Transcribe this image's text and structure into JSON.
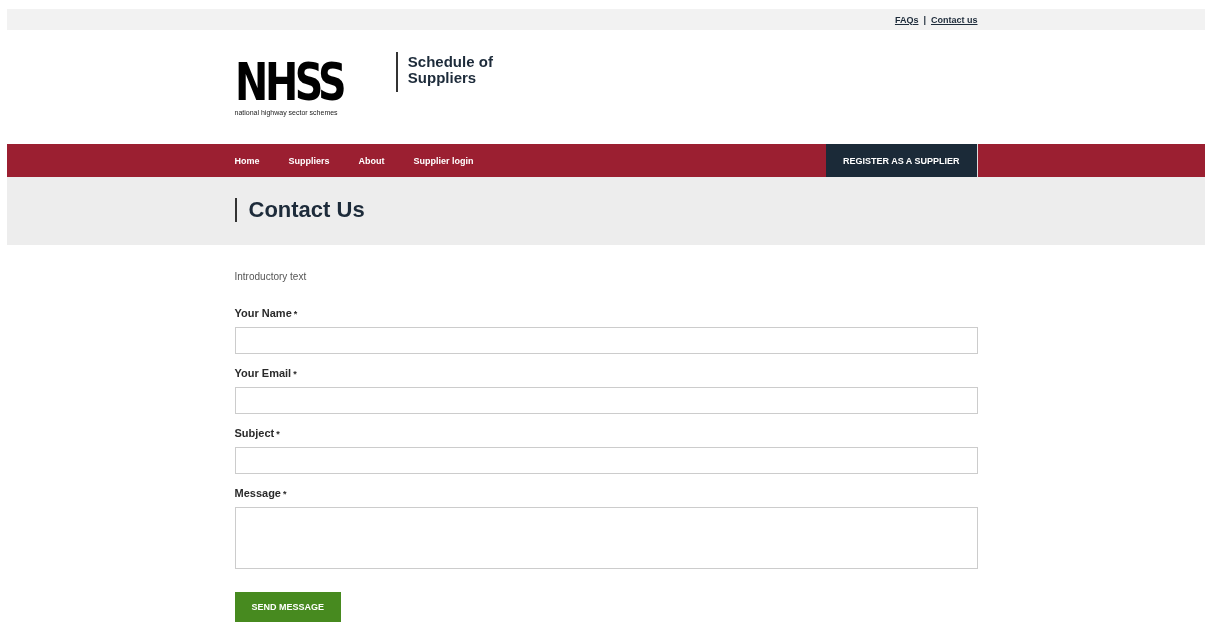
{
  "top_links": [
    {
      "label": "FAQs"
    },
    {
      "label": "Contact us"
    }
  ],
  "top_separator": "|",
  "logo": {
    "mark": "NHSS",
    "tagline": "national highway sector schemes"
  },
  "site_title": "Schedule of Suppliers",
  "nav": {
    "items": [
      {
        "label": "Home"
      },
      {
        "label": "Suppliers"
      },
      {
        "label": "About"
      },
      {
        "label": "Supplier login"
      }
    ],
    "cta": "REGISTER AS A SUPPLIER"
  },
  "page_title": "Contact Us",
  "intro": "Introductory text",
  "fields": [
    {
      "label": "Your Name",
      "required_mark": "*",
      "kind": "text"
    },
    {
      "label": "Your Email",
      "required_mark": "*",
      "kind": "text"
    },
    {
      "label": "Subject",
      "required_mark": "*",
      "kind": "text"
    },
    {
      "label": "Message",
      "required_mark": "*",
      "kind": "textarea"
    }
  ],
  "submit": "SEND MESSAGE"
}
